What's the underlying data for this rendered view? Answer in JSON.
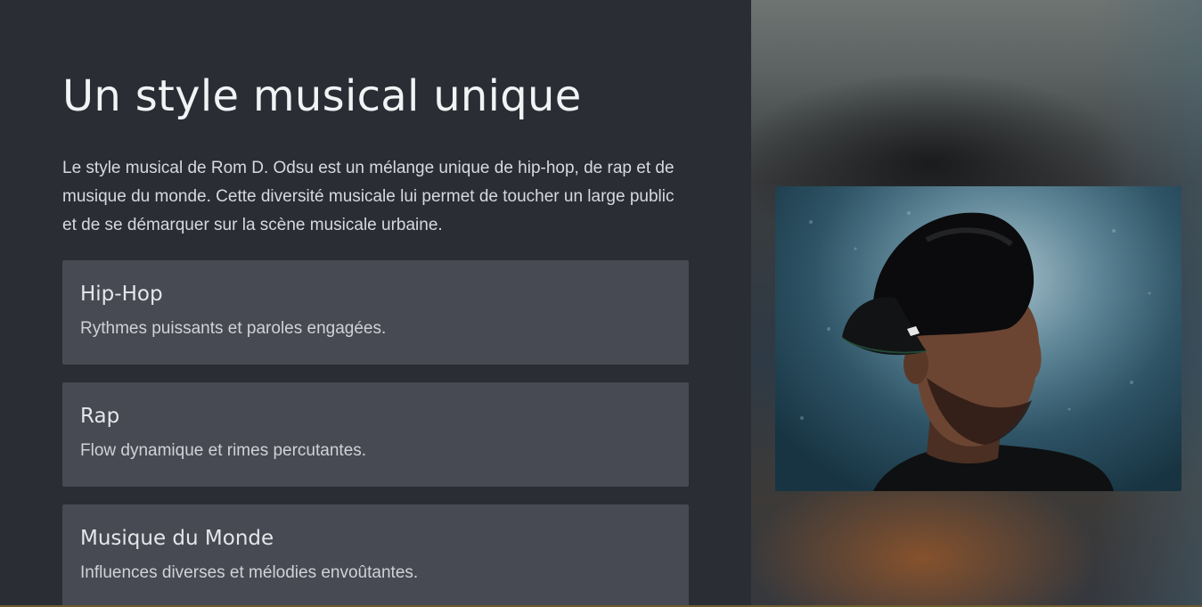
{
  "section": {
    "title": "Un style musical unique",
    "intro": "Le style musical de Rom D. Odsu est un mélange unique de hip-hop, de rap et de musique du monde. Cette diversité musicale lui permet de toucher un large public et de se démarquer sur la scène musicale urbaine."
  },
  "styles": [
    {
      "title": "Hip-Hop",
      "description": "Rythmes puissants et paroles engagées."
    },
    {
      "title": "Rap",
      "description": "Flow dynamique et rimes percutantes."
    },
    {
      "title": "Musique du Monde",
      "description": "Influences diverses et mélodies envoûtantes."
    }
  ],
  "colors": {
    "background": "#2a2d34",
    "card": "#474a53",
    "heading": "#f2f3f5",
    "text": "#d7d9de"
  }
}
